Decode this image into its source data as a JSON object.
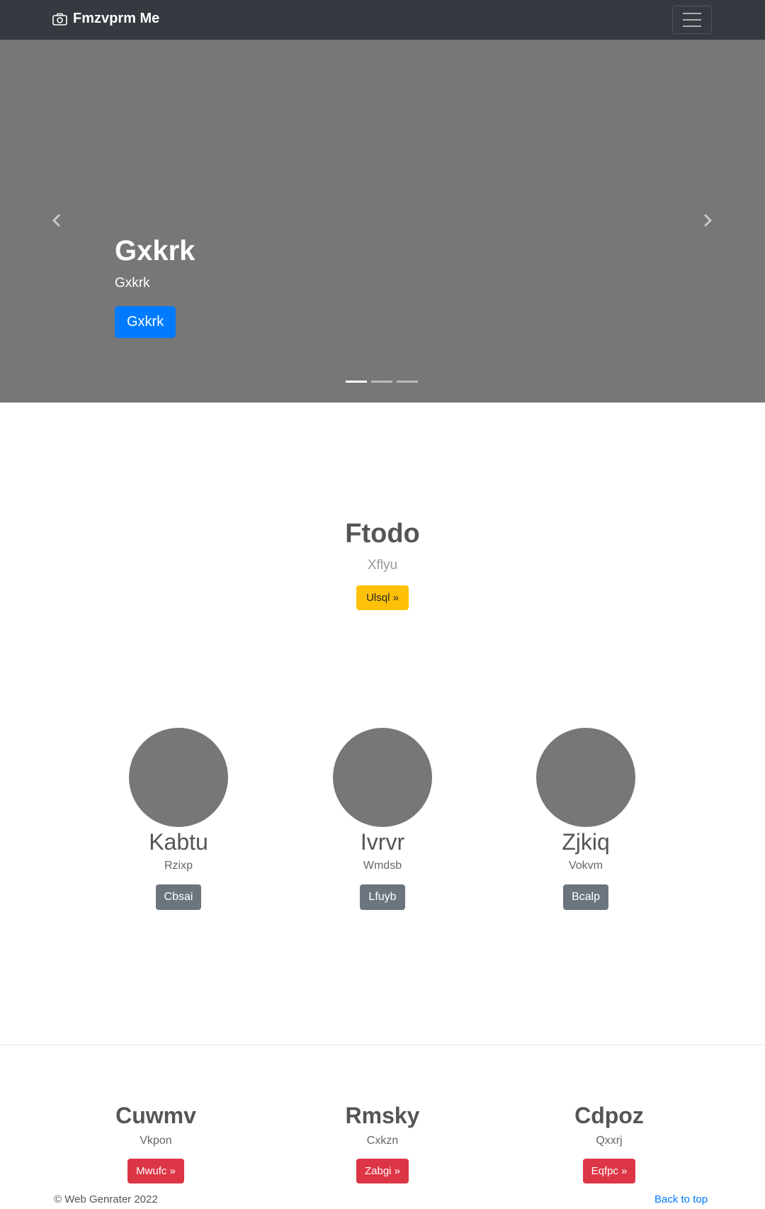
{
  "navbar": {
    "brand": "Fmzvprm Me",
    "brand_icon": "camera-icon",
    "toggler_icon": "hamburger-menu-icon"
  },
  "carousel": {
    "title": "Gxkrk",
    "subtitle": "Gxkrk",
    "button_label": "Gxkrk",
    "prev_icon": "chevron-left-icon",
    "next_icon": "chevron-right-icon",
    "slide_count": 3,
    "active_slide": 1
  },
  "feature": {
    "title": "Ftodo",
    "subtitle": "Xflyu",
    "button_label": "Ulsql »"
  },
  "circles": [
    {
      "title": "Kabtu",
      "subtitle": "Rzixp",
      "button_label": "Cbsai"
    },
    {
      "title": "Ivrvr",
      "subtitle": "Wmdsb",
      "button_label": "Lfuyb"
    },
    {
      "title": "Zjkiq",
      "subtitle": "Vokvm",
      "button_label": "Bcalp"
    }
  ],
  "columns": [
    {
      "title": "Cuwmv",
      "subtitle": "Vkpon",
      "button_label": "Mwufc »"
    },
    {
      "title": "Rmsky",
      "subtitle": "Cxkzn",
      "button_label": "Zabgi »"
    },
    {
      "title": "Cdpoz",
      "subtitle": "Qxxrj",
      "button_label": "Eqfpc »"
    }
  ],
  "footer": {
    "copyright": "© Web Genrater 2022",
    "back_to_top": "Back to top"
  },
  "colors": {
    "navbar": "#343a40",
    "hero": "#777777",
    "primary": "#007bff",
    "warning": "#ffc107",
    "secondary": "#6c757d",
    "danger": "#dc3545"
  }
}
